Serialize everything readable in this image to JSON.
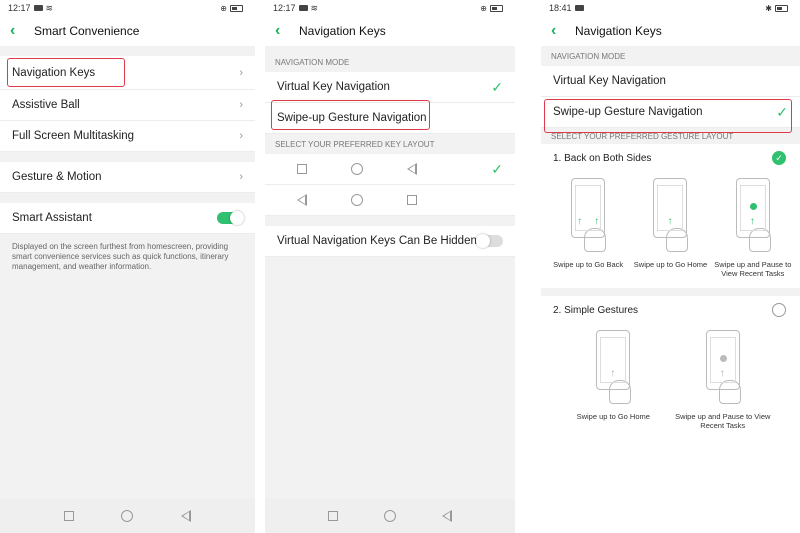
{
  "screen1": {
    "status": {
      "time": "12:17"
    },
    "header": {
      "title": "Smart Convenience"
    },
    "items": [
      {
        "label": "Navigation Keys"
      },
      {
        "label": "Assistive Ball"
      },
      {
        "label": "Full Screen Multitasking"
      }
    ],
    "gesture_label": "Gesture & Motion",
    "assistant_label": "Smart Assistant",
    "assistant_desc": "Displayed on the screen furthest from homescreen, providing smart convenience services such as quick functions, itinerary management, and weather information."
  },
  "screen2": {
    "status": {
      "time": "12:17"
    },
    "header": {
      "title": "Navigation Keys"
    },
    "mode_section": "NAVIGATION MODE",
    "mode_virtual": "Virtual Key Navigation",
    "mode_swipe": "Swipe-up Gesture Navigation",
    "layout_section": "SELECT YOUR PREFERRED KEY LAYOUT",
    "hidden_label": "Virtual Navigation Keys Can Be Hidden"
  },
  "screen3": {
    "status": {
      "time": "18:41"
    },
    "header": {
      "title": "Navigation Keys"
    },
    "mode_section": "NAVIGATION MODE",
    "mode_virtual": "Virtual Key Navigation",
    "mode_swipe": "Swipe-up Gesture Navigation",
    "layout_section": "SELECT YOUR PREFERRED GESTURE LAYOUT",
    "opt1": {
      "label": "1. Back on Both Sides",
      "captions": [
        "Swipe up to Go Back",
        "Swipe up to Go Home",
        "Swipe up and Pause to View Recent Tasks"
      ]
    },
    "opt2": {
      "label": "2. Simple Gestures",
      "captions": [
        "Swipe up to Go Home",
        "Swipe up and Pause to View Recent Tasks"
      ]
    }
  },
  "colors": {
    "accent": "#2fc070",
    "highlight": "#e03a4a"
  }
}
